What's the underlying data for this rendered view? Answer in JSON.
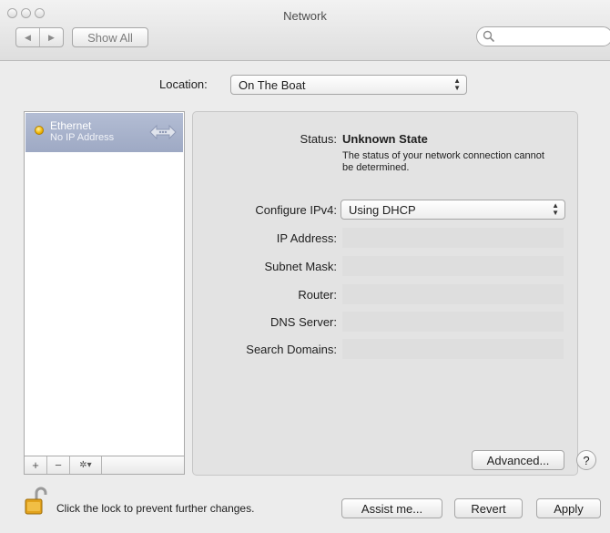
{
  "window": {
    "title": "Network"
  },
  "toolbar": {
    "back_glyph": "◀",
    "forward_glyph": "▶",
    "show_all_label": "Show All",
    "search_placeholder": ""
  },
  "location": {
    "label": "Location:",
    "value": "On The Boat"
  },
  "services": [
    {
      "name": "Ethernet",
      "status": "No IP Address",
      "icon": "ethernet-arrows-icon",
      "status_color": "#f0b400"
    }
  ],
  "sidebar_buttons": {
    "add": "+",
    "remove": "−",
    "gear": "✲▾"
  },
  "details": {
    "status_label": "Status:",
    "status_value": "Unknown State",
    "status_description": "The status of your network connection cannot be determined.",
    "configure_label": "Configure IPv4:",
    "configure_value": "Using DHCP",
    "fields": [
      {
        "label": "IP Address:",
        "value": ""
      },
      {
        "label": "Subnet Mask:",
        "value": ""
      },
      {
        "label": "Router:",
        "value": ""
      },
      {
        "label": "DNS Server:",
        "value": ""
      },
      {
        "label": "Search Domains:",
        "value": ""
      }
    ],
    "advanced_label": "Advanced...",
    "help_label": "?"
  },
  "footer": {
    "lock_text": "Click the lock to prevent further changes.",
    "assist_label": "Assist me...",
    "revert_label": "Revert",
    "apply_label": "Apply"
  },
  "colors": {
    "selection": "#a6b0ca",
    "status_dot": "#f0b400"
  }
}
